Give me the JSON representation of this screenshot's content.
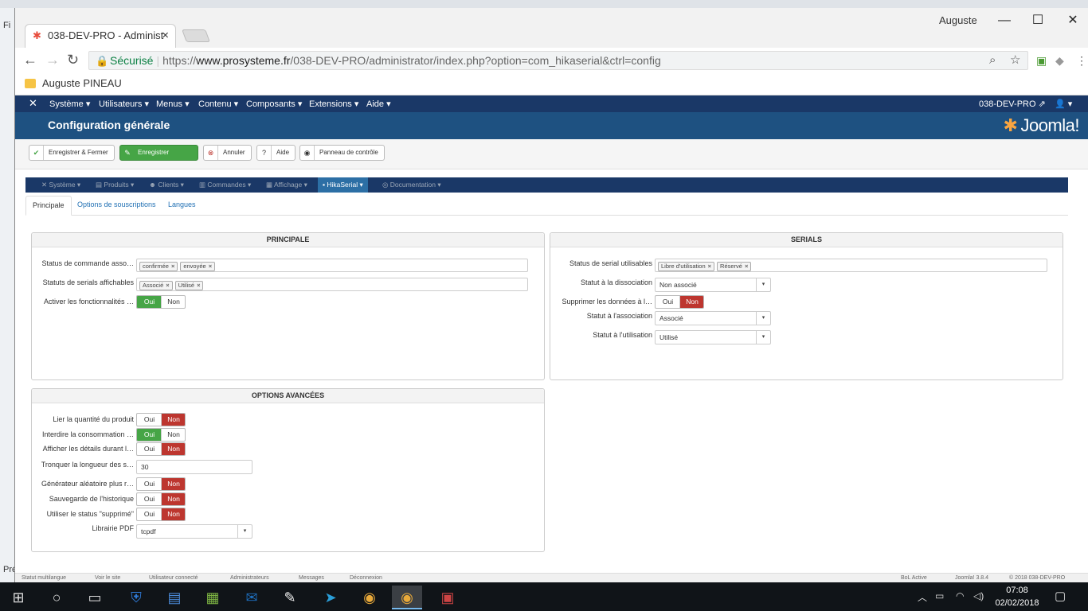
{
  "browser": {
    "tab_title": "038-DEV-PRO - Administ",
    "window_user": "Auguste",
    "security_label": "Sécurisé",
    "url_scheme": "https://",
    "url_host": "www.prosysteme.fr",
    "url_path": "/038-DEV-PRO/administrator/index.php?option=com_hikaserial&ctrl=config",
    "bookmark": "Auguste PINEAU"
  },
  "joomla": {
    "menu": [
      "Système",
      "Utilisateurs",
      "Menus",
      "Contenu",
      "Composants",
      "Extensions",
      "Aide"
    ],
    "site_link": "038-DEV-PRO",
    "page_title": "Configuration générale",
    "logo_text": "Joomla!",
    "toolbar": {
      "save_close": "Enregistrer & Fermer",
      "save": "Enregistrer",
      "cancel": "Annuler",
      "help": "Aide",
      "control_panel": "Panneau de contrôle"
    }
  },
  "hika_nav": [
    "Système",
    "Produits",
    "Clients",
    "Commandes",
    "Affichage",
    "HikaSerial",
    "Documentation"
  ],
  "subtabs": [
    "Principale",
    "Options de souscriptions",
    "Langues"
  ],
  "principale": {
    "title": "PRINCIPALE",
    "order_status_label": "Status de commande asso…",
    "order_status_chips": [
      "confirmée",
      "envoyée"
    ],
    "displayable_label": "Statuts de serials affichables",
    "displayable_chips": [
      "Associé",
      "Utilisé"
    ],
    "activate_label": "Activer les fonctionnalités …",
    "yes": "Oui",
    "no": "Non"
  },
  "serials": {
    "title": "SERIALS",
    "usable_label": "Status de serial utilisables",
    "usable_chips": [
      "Libre d'utilisation",
      "Réservé"
    ],
    "dissoc_label": "Statut à la dissociation",
    "dissoc_value": "Non associé",
    "delete_label": "Supprimer les données à l…",
    "assoc_label": "Statut à l'association",
    "assoc_value": "Associé",
    "use_label": "Statut à l'utilisation",
    "use_value": "Utilisé"
  },
  "advanced": {
    "title": "OPTIONS AVANCÉES",
    "rows": [
      {
        "label": "Lier la quantité du produit",
        "state": "Non"
      },
      {
        "label": "Interdire la consommation …",
        "state": "Oui"
      },
      {
        "label": "Afficher les détails durant l…",
        "state": "Non"
      },
      {
        "label": "Générateur aléatoire plus r…",
        "state": "Non"
      },
      {
        "label": "Sauvegarde de l'historique",
        "state": "Non"
      },
      {
        "label": "Utiliser le status \"supprimé\"",
        "state": "Non"
      }
    ],
    "truncate_label": "Tronquer la longueur des s…",
    "truncate_value": "30",
    "pdf_label": "Librairie PDF",
    "pdf_value": "tcpdf"
  },
  "statusbar": {
    "items": [
      "Statut multilangue",
      "Voir le site",
      "Utilisateur connecté",
      "Administrateurs",
      "Messages",
      "Déconnexion"
    ],
    "right": [
      "BoL Active",
      "Joomla! 3.8.4",
      "© 2018 038-DEV-PRO"
    ]
  },
  "taskbar": {
    "time": "07:08",
    "date": "02/02/2018"
  }
}
